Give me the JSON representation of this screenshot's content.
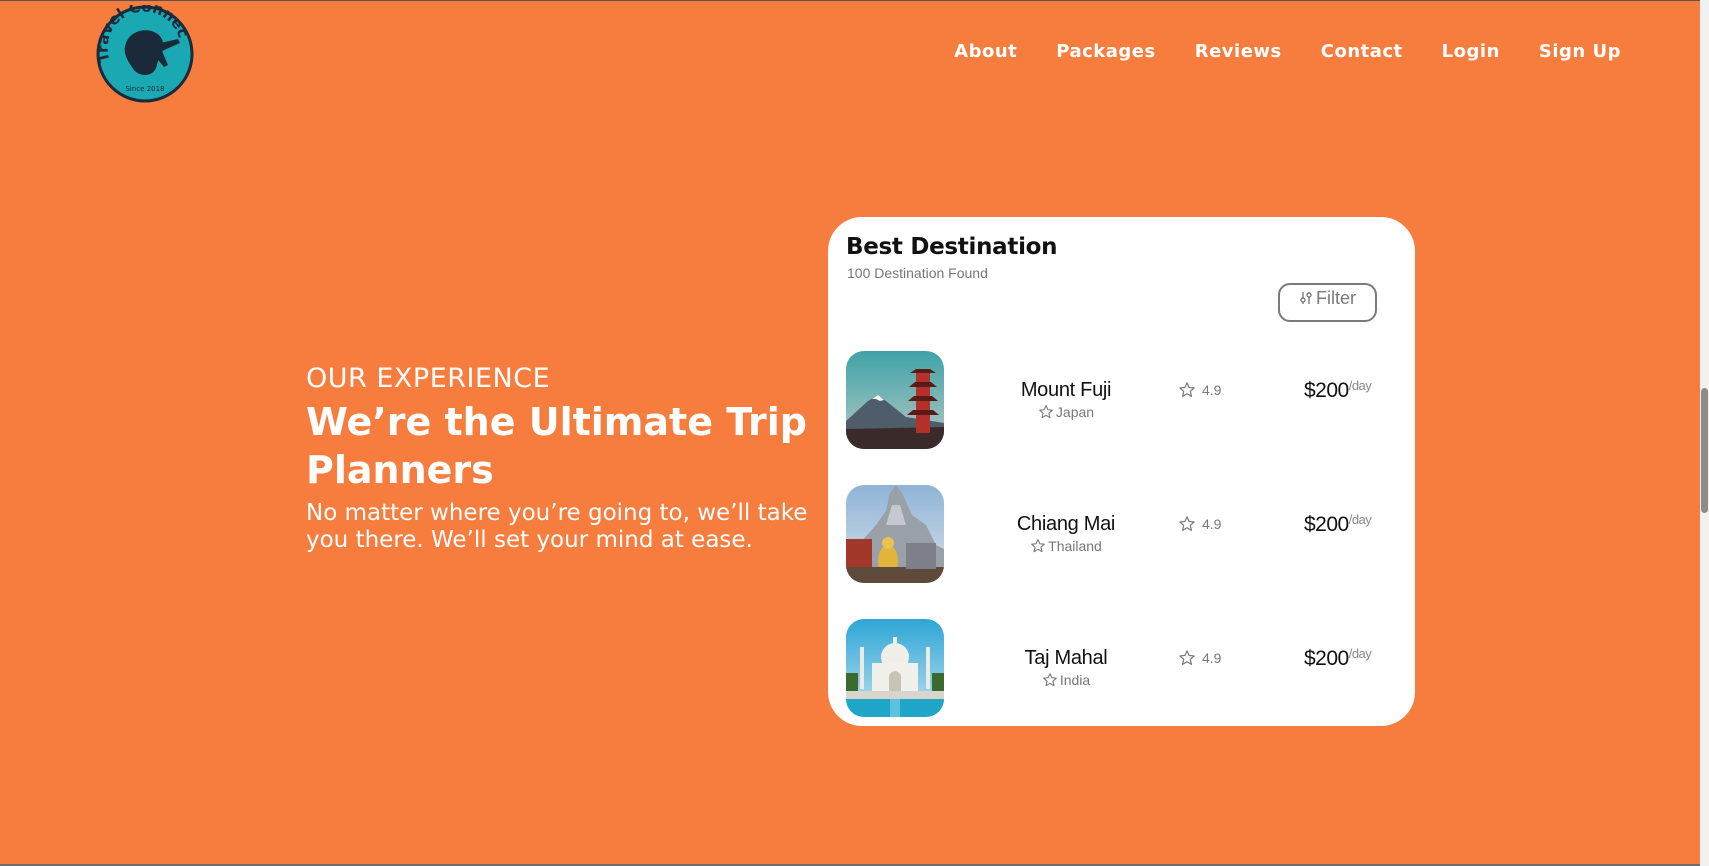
{
  "brand": {
    "logo_text": "Travel Connect",
    "logo_since": "Since 2018",
    "colors": {
      "background": "#f77d3f",
      "logo_teal": "#1aa9b3",
      "logo_dark": "#1b2a3a"
    }
  },
  "nav": {
    "items": [
      {
        "label": "About"
      },
      {
        "label": "Packages"
      },
      {
        "label": "Reviews"
      },
      {
        "label": "Contact"
      },
      {
        "label": "Login"
      },
      {
        "label": "Sign Up"
      }
    ]
  },
  "hero": {
    "eyebrow": "OUR EXPERIENCE",
    "headline": "We’re the Ultimate Trip Planners",
    "subtext": "No matter where you’re going to, we’ll take you there. We’ll set your mind at ease."
  },
  "card": {
    "title": "Best Destination",
    "subtitle": "100 Destination Found",
    "filter_label": "Filter",
    "filter_icon": "sliders-icon",
    "destinations": [
      {
        "name": "Mount Fuji",
        "country": "Japan",
        "rating": "4.9",
        "price": "$200",
        "unit": "/day"
      },
      {
        "name": "Chiang Mai",
        "country": "Thailand",
        "rating": "4.9",
        "price": "$200",
        "unit": "/day"
      },
      {
        "name": "Taj Mahal",
        "country": "India",
        "rating": "4.9",
        "price": "$200",
        "unit": "/day"
      }
    ]
  }
}
